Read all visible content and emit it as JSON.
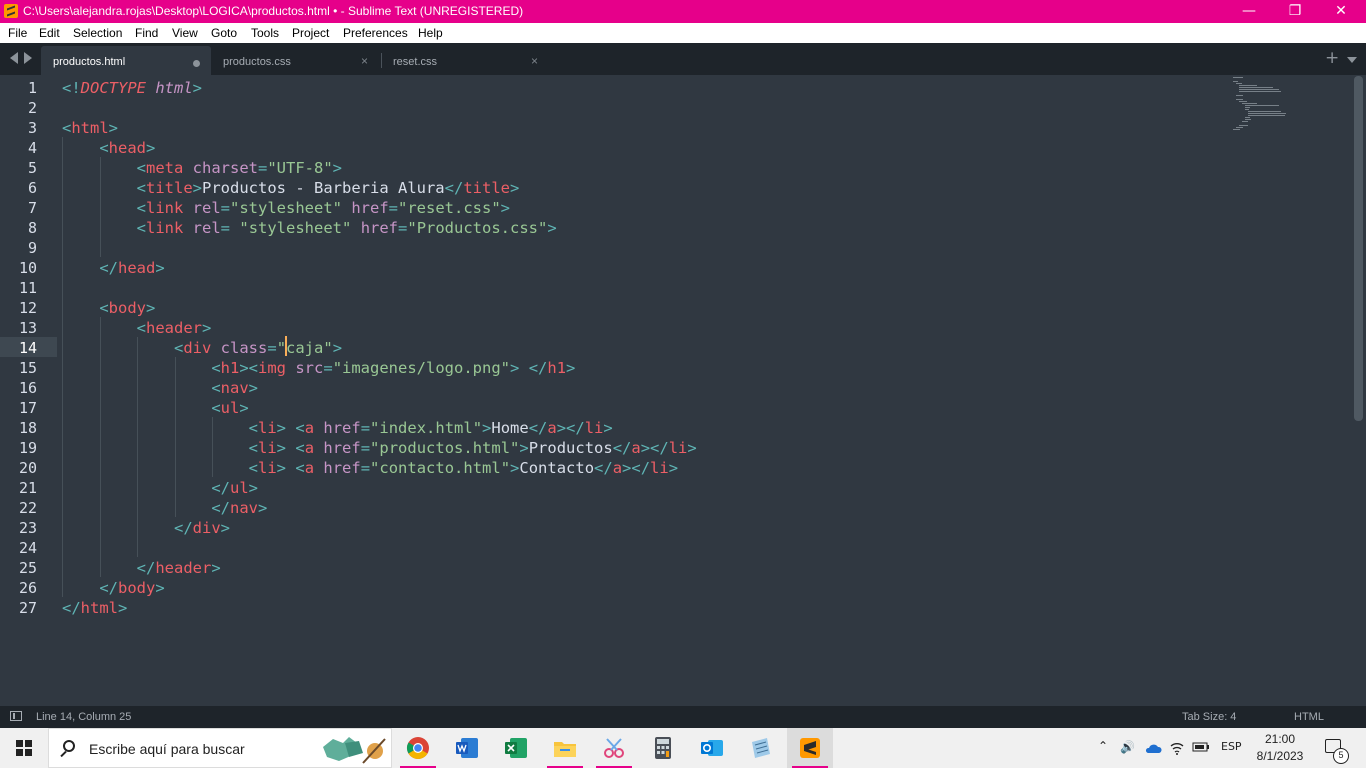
{
  "window": {
    "title": "C:\\Users\\alejandra.rojas\\Desktop\\LOGICA\\productos.html • - Sublime Text (UNREGISTERED)",
    "minimize_glyph": "—",
    "restore_glyph": "❐",
    "close_glyph": "✕"
  },
  "menu": [
    "File",
    "Edit",
    "Selection",
    "Find",
    "View",
    "Goto",
    "Tools",
    "Project",
    "Preferences",
    "Help"
  ],
  "tabs": [
    {
      "label": "productos.html",
      "active": true,
      "dirty": true
    },
    {
      "label": "productos.css",
      "active": false
    },
    {
      "label": "reset.css",
      "active": false
    }
  ],
  "tabbar_icons": {
    "add": "+",
    "close": "×"
  },
  "editor": {
    "line_numbers": [
      "1",
      "2",
      "3",
      "4",
      "5",
      "6",
      "7",
      "8",
      "9",
      "10",
      "11",
      "12",
      "13",
      "14",
      "15",
      "16",
      "17",
      "18",
      "19",
      "20",
      "21",
      "22",
      "23",
      "24",
      "25",
      "26",
      "27"
    ],
    "current_line": "14",
    "lines": [
      [
        [
          "p",
          "<!"
        ],
        [
          "t i",
          "DOCTYPE"
        ],
        [
          "x",
          " "
        ],
        [
          "a i",
          "html"
        ],
        [
          "p",
          ">"
        ]
      ],
      [],
      [
        [
          "p",
          "<"
        ],
        [
          "t",
          "html"
        ],
        [
          "p",
          ">"
        ]
      ],
      [
        [
          "x",
          "    "
        ],
        [
          "p",
          "<"
        ],
        [
          "t",
          "head"
        ],
        [
          "p",
          ">"
        ]
      ],
      [
        [
          "x",
          "        "
        ],
        [
          "p",
          "<"
        ],
        [
          "t",
          "meta"
        ],
        [
          "x",
          " "
        ],
        [
          "a",
          "charset"
        ],
        [
          "p",
          "="
        ],
        [
          "s",
          "\"UTF-8\""
        ],
        [
          "p",
          ">"
        ]
      ],
      [
        [
          "x",
          "        "
        ],
        [
          "p",
          "<"
        ],
        [
          "t",
          "title"
        ],
        [
          "p",
          ">"
        ],
        [
          "x",
          "Productos - Barberia Alura"
        ],
        [
          "p",
          "</"
        ],
        [
          "t",
          "title"
        ],
        [
          "p",
          ">"
        ]
      ],
      [
        [
          "x",
          "        "
        ],
        [
          "p",
          "<"
        ],
        [
          "t",
          "link"
        ],
        [
          "x",
          " "
        ],
        [
          "a",
          "rel"
        ],
        [
          "p",
          "="
        ],
        [
          "s",
          "\"stylesheet\""
        ],
        [
          "x",
          " "
        ],
        [
          "a",
          "href"
        ],
        [
          "p",
          "="
        ],
        [
          "s",
          "\"reset.css\""
        ],
        [
          "p",
          ">"
        ]
      ],
      [
        [
          "x",
          "        "
        ],
        [
          "p",
          "<"
        ],
        [
          "t",
          "link"
        ],
        [
          "x",
          " "
        ],
        [
          "a",
          "rel"
        ],
        [
          "p",
          "="
        ],
        [
          "x",
          " "
        ],
        [
          "s",
          "\"stylesheet\""
        ],
        [
          "x",
          " "
        ],
        [
          "a",
          "href"
        ],
        [
          "p",
          "="
        ],
        [
          "s",
          "\"Productos.css\""
        ],
        [
          "p",
          ">"
        ]
      ],
      [],
      [
        [
          "x",
          "    "
        ],
        [
          "p",
          "</"
        ],
        [
          "t",
          "head"
        ],
        [
          "p",
          ">"
        ]
      ],
      [],
      [
        [
          "x",
          "    "
        ],
        [
          "p",
          "<"
        ],
        [
          "t",
          "body"
        ],
        [
          "p",
          ">"
        ]
      ],
      [
        [
          "x",
          "        "
        ],
        [
          "p",
          "<"
        ],
        [
          "t",
          "header"
        ],
        [
          "p",
          ">"
        ]
      ],
      [
        [
          "x",
          "            "
        ],
        [
          "p",
          "<"
        ],
        [
          "t",
          "div"
        ],
        [
          "x",
          " "
        ],
        [
          "a",
          "class"
        ],
        [
          "p",
          "="
        ],
        [
          "s",
          "\"caja\""
        ],
        [
          "p",
          ">"
        ]
      ],
      [
        [
          "x",
          "                "
        ],
        [
          "p",
          "<"
        ],
        [
          "t",
          "h1"
        ],
        [
          "p",
          "><"
        ],
        [
          "t",
          "img"
        ],
        [
          "x",
          " "
        ],
        [
          "a",
          "src"
        ],
        [
          "p",
          "="
        ],
        [
          "s",
          "\"imagenes/logo.png\""
        ],
        [
          "p",
          ">"
        ],
        [
          "x",
          " "
        ],
        [
          "p",
          "</"
        ],
        [
          "t",
          "h1"
        ],
        [
          "p",
          ">"
        ]
      ],
      [
        [
          "x",
          "                "
        ],
        [
          "p",
          "<"
        ],
        [
          "t",
          "nav"
        ],
        [
          "p",
          ">"
        ]
      ],
      [
        [
          "x",
          "                "
        ],
        [
          "p",
          "<"
        ],
        [
          "t",
          "ul"
        ],
        [
          "p",
          ">"
        ]
      ],
      [
        [
          "x",
          "                    "
        ],
        [
          "p",
          "<"
        ],
        [
          "t",
          "li"
        ],
        [
          "p",
          ">"
        ],
        [
          "x",
          " "
        ],
        [
          "p",
          "<"
        ],
        [
          "t",
          "a"
        ],
        [
          "x",
          " "
        ],
        [
          "a",
          "href"
        ],
        [
          "p",
          "="
        ],
        [
          "s",
          "\"index.html\""
        ],
        [
          "p",
          ">"
        ],
        [
          "x",
          "Home"
        ],
        [
          "p",
          "</"
        ],
        [
          "t",
          "a"
        ],
        [
          "p",
          "></"
        ],
        [
          "t",
          "li"
        ],
        [
          "p",
          ">"
        ]
      ],
      [
        [
          "x",
          "                    "
        ],
        [
          "p",
          "<"
        ],
        [
          "t",
          "li"
        ],
        [
          "p",
          ">"
        ],
        [
          "x",
          " "
        ],
        [
          "p",
          "<"
        ],
        [
          "t",
          "a"
        ],
        [
          "x",
          " "
        ],
        [
          "a",
          "href"
        ],
        [
          "p",
          "="
        ],
        [
          "s",
          "\"productos.html\""
        ],
        [
          "p",
          ">"
        ],
        [
          "x",
          "Productos"
        ],
        [
          "p",
          "</"
        ],
        [
          "t",
          "a"
        ],
        [
          "p",
          "></"
        ],
        [
          "t",
          "li"
        ],
        [
          "p",
          ">"
        ]
      ],
      [
        [
          "x",
          "                    "
        ],
        [
          "p",
          "<"
        ],
        [
          "t",
          "li"
        ],
        [
          "p",
          ">"
        ],
        [
          "x",
          " "
        ],
        [
          "p",
          "<"
        ],
        [
          "t",
          "a"
        ],
        [
          "x",
          " "
        ],
        [
          "a",
          "href"
        ],
        [
          "p",
          "="
        ],
        [
          "s",
          "\"contacto.html\""
        ],
        [
          "p",
          ">"
        ],
        [
          "x",
          "Contacto"
        ],
        [
          "p",
          "</"
        ],
        [
          "t",
          "a"
        ],
        [
          "p",
          "></"
        ],
        [
          "t",
          "li"
        ],
        [
          "p",
          ">"
        ]
      ],
      [
        [
          "x",
          "                "
        ],
        [
          "p",
          "</"
        ],
        [
          "t",
          "ul"
        ],
        [
          "p",
          ">"
        ]
      ],
      [
        [
          "x",
          "                "
        ],
        [
          "p",
          "</"
        ],
        [
          "t",
          "nav"
        ],
        [
          "p",
          ">"
        ]
      ],
      [
        [
          "x",
          "            "
        ],
        [
          "p",
          "</"
        ],
        [
          "t",
          "div"
        ],
        [
          "p",
          ">"
        ]
      ],
      [],
      [
        [
          "x",
          "        "
        ],
        [
          "p",
          "</"
        ],
        [
          "t",
          "header"
        ],
        [
          "p",
          ">"
        ]
      ],
      [
        [
          "x",
          "    "
        ],
        [
          "p",
          "</"
        ],
        [
          "t",
          "body"
        ],
        [
          "p",
          ">"
        ]
      ],
      [
        [
          "p",
          "</"
        ],
        [
          "t",
          "html"
        ],
        [
          "p",
          ">"
        ]
      ]
    ]
  },
  "status": {
    "position": "Line 14, Column 25",
    "tab_size": "Tab Size: 4",
    "syntax": "HTML"
  },
  "taskbar": {
    "search_placeholder": "Escribe aquí para buscar",
    "apps": [
      "chrome-icon",
      "word-icon",
      "excel-icon",
      "file-explorer-icon",
      "snipping-tool-icon",
      "calculator-icon",
      "outlook-icon",
      "notepad-icon",
      "sublime-text-icon"
    ],
    "language": "ESP",
    "time": "21:00",
    "date": "8/1/2023",
    "notification_count": "5"
  },
  "colors": {
    "titlebar": "#e6008a",
    "editor_bg": "#303841",
    "punctuation": "#5fb4b4",
    "tag": "#ec5f66",
    "attribute": "#c695c6",
    "string": "#99c794",
    "text": "#d8dee9",
    "cursor": "#f9ae58"
  }
}
